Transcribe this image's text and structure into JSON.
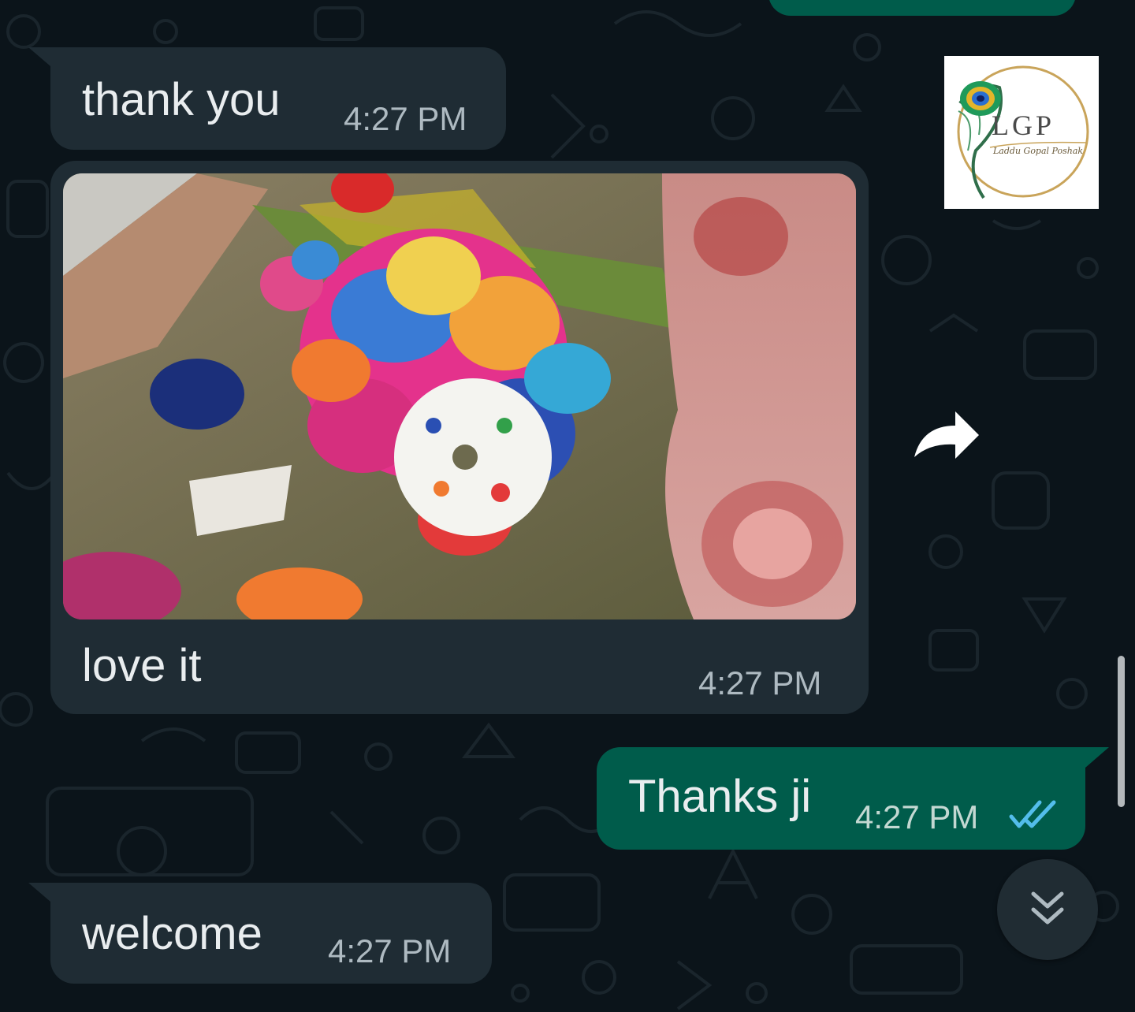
{
  "chat": {
    "messages": [
      {
        "direction": "incoming",
        "text": "thank you",
        "time": "4:27 PM"
      },
      {
        "direction": "incoming",
        "type": "image",
        "caption": "love it",
        "time": "4:27 PM"
      },
      {
        "direction": "outgoing",
        "text": "Thanks ji",
        "time": "4:27 PM",
        "status": "read"
      },
      {
        "direction": "incoming",
        "text": "welcome",
        "time": "4:27 PM"
      }
    ]
  },
  "logo": {
    "initials": "LGP",
    "tagline": "Laddu Gopal Poshak"
  },
  "icons": {
    "forward": "forward-arrow-icon",
    "read_receipt": "double-check-icon",
    "scroll_down": "double-chevron-down-icon"
  },
  "colors": {
    "background": "#0b141a",
    "incoming_bubble": "#1f2c34",
    "outgoing_bubble": "#005c4b",
    "read_tick": "#53bdeb"
  }
}
